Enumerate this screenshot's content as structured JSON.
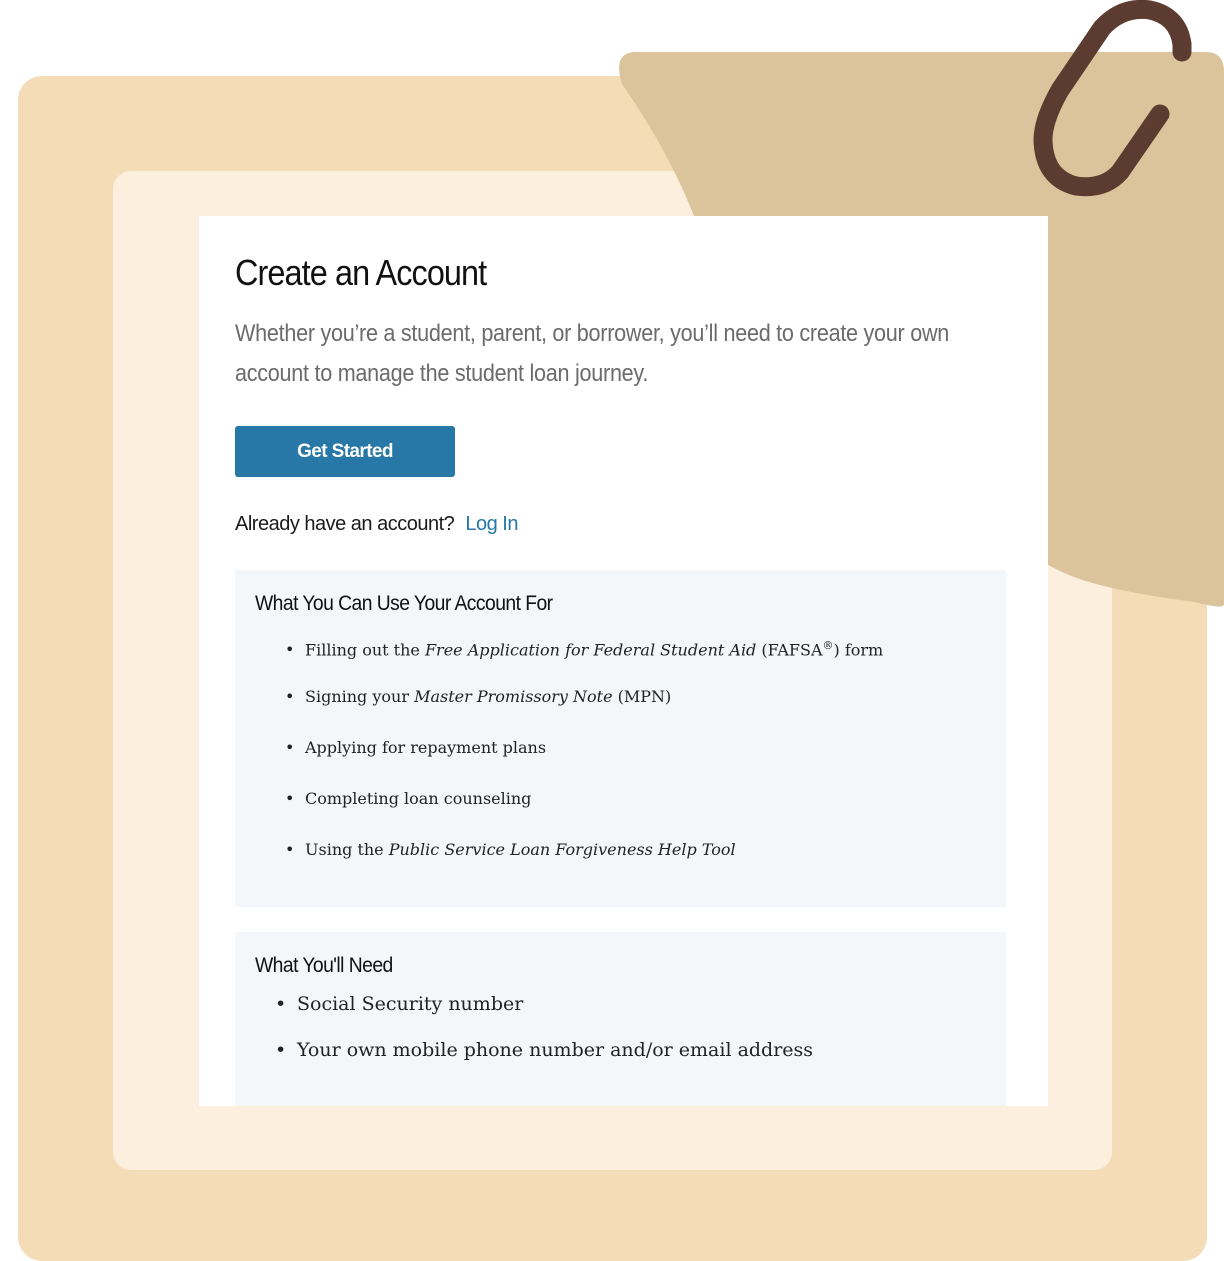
{
  "colors": {
    "outer_frame": "#f4dcb7",
    "inner_frame": "#fdefde",
    "folder_tab": "#dbc49b",
    "paperclip": "#5c3b30",
    "button": "#2778a6",
    "link": "#2778a6",
    "panel": "#f3f7fa"
  },
  "decoration": {
    "clip_icon": "paperclip-icon"
  },
  "page": {
    "title": "Create an Account",
    "intro": "Whether you’re a student, parent, or borrower, you’ll need to create your own account to manage the student loan journey.",
    "cta_label": "Get Started",
    "login_prompt": "Already have an account?",
    "login_link": "Log In"
  },
  "uses": {
    "title": "What You Can Use Your Account For",
    "items": [
      {
        "pre": "Filling out the ",
        "em": "Free Application for Federal Student Aid",
        "post": " (FAFSA",
        "sup": "®",
        "post2": ") form"
      },
      {
        "pre": "Signing your ",
        "em": "Master Promissory Note",
        "post": " (MPN)"
      },
      {
        "pre": "Applying for repayment plans"
      },
      {
        "pre": "Completing loan counseling"
      },
      {
        "pre": "Using the ",
        "em": "Public Service Loan Forgiveness Help Tool"
      }
    ]
  },
  "needs": {
    "title": "What You'll Need",
    "items": [
      "Social Security number",
      "Your own mobile phone number and/or email address"
    ]
  }
}
